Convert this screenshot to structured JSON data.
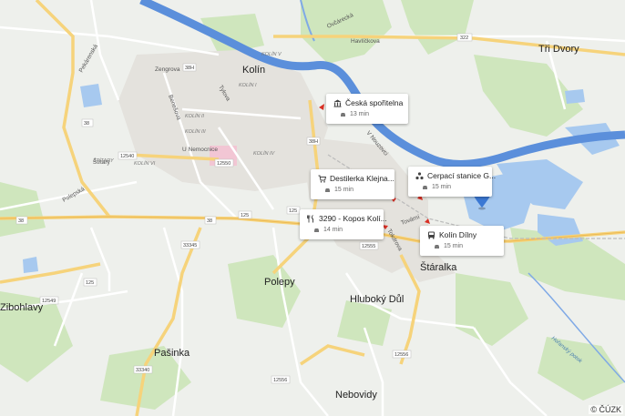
{
  "map": {
    "towns": [
      "Kolín",
      "Tři Dvory",
      "Polepy",
      "Hluboký Důl",
      "Štáralka",
      "Zibohlavy",
      "Pašinka",
      "Nebovidy"
    ],
    "streets": [
      "Ovčárecká",
      "Havlíčkova",
      "V Nouzovci",
      "Tovární",
      "Tokdrova",
      "Zengrova",
      "U Nemocnice",
      "Pekárenská",
      "Polepská",
      "Benešova",
      "Tylova",
      "Štítary"
    ],
    "districts": [
      "KOLÍN II",
      "KOLÍN III",
      "KOLÍN IV",
      "KOLÍN V",
      "KOLÍN VI",
      "KOLÍN I",
      "ŠTÍTARY"
    ],
    "road_numbers": [
      "322",
      "38",
      "38",
      "38",
      "125",
      "125",
      "125",
      "12540",
      "12550",
      "12555",
      "12549",
      "12556",
      "12556",
      "33345",
      "33340",
      "38H",
      "38H"
    ],
    "water_label": "Hořanský potok",
    "copyright": "© ČÚZK"
  },
  "cards": [
    {
      "name": "Česká spořitelna",
      "time": "13 min",
      "icon": "bank-icon"
    },
    {
      "name": "Destilerka Klejna...",
      "time": "15 min",
      "icon": "cart-icon"
    },
    {
      "name": "Cerpací stanice G...",
      "time": "15 min",
      "icon": "fuel-icon"
    },
    {
      "name": "3290 - Kopos Kolí...",
      "time": "14 min",
      "icon": "restaurant-icon"
    },
    {
      "name": "Kolín Dílny",
      "time": "15 min",
      "icon": "bus-icon"
    }
  ],
  "colors": {
    "water": "#a7c9ef",
    "river": "#5b8fdb",
    "road": "#f6d37b",
    "park": "#c8e2b4",
    "marker": "#3b78d4"
  }
}
